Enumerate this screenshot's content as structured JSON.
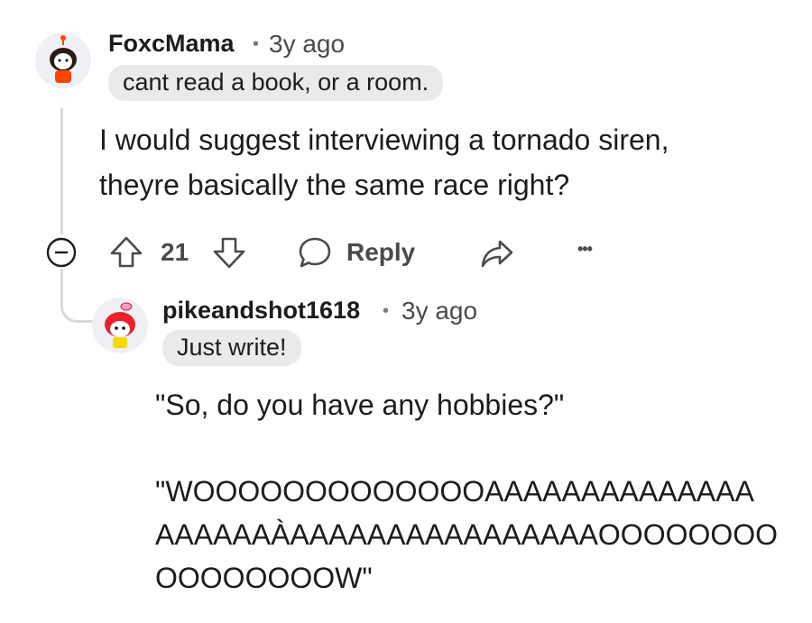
{
  "comments": [
    {
      "username": "FoxcMama",
      "separator": "•",
      "time": "3y ago",
      "flair": "cant read a book, or a room.",
      "body_lines": [
        "I would suggest interviewing a tornado siren,",
        "theyre basically the same race right?"
      ],
      "actions": {
        "vote_count": "21",
        "reply_label": "Reply",
        "more_label": "•••"
      }
    },
    {
      "username": "pikeandshot1618",
      "separator": "•",
      "time": "3y ago",
      "flair": "Just write!",
      "body_lines": [
        "\"So, do you have any hobbies?\"",
        "",
        "\"WOOOOOOOOOOOOOAAAAAAAAAAAAAA",
        "AAAAAAÀAAAAAAAAAAAAAAAAOOOOOOOO",
        "OOOOOOOOW\""
      ]
    }
  ],
  "icons": {
    "collapse": "collapse-icon",
    "upvote": "upvote-arrow-icon",
    "downvote": "downvote-arrow-icon",
    "reply": "speech-bubble-icon",
    "share": "share-arrow-icon"
  }
}
